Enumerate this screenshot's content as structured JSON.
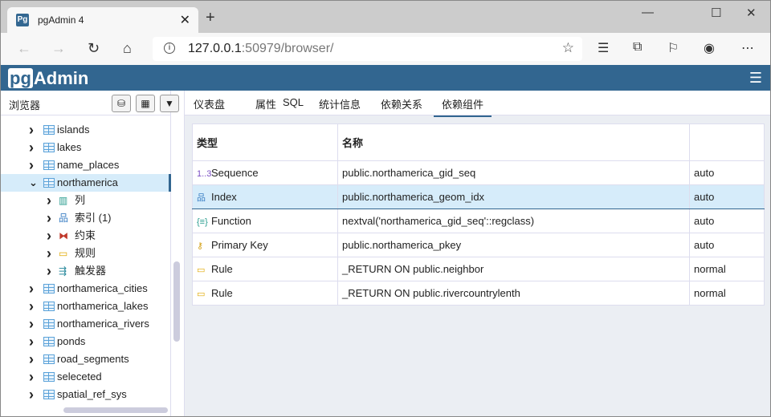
{
  "browser": {
    "tab_title": "pgAdmin 4",
    "favicon": "Pg",
    "url_host": "127.0.0.1",
    "url_rest": ":50979/browser/"
  },
  "app": {
    "logo_pg": "pg",
    "logo_rest": "Admin"
  },
  "left": {
    "title": "浏览器",
    "tree": [
      {
        "label": "islands",
        "level": 1,
        "icon": "table",
        "expanded": false
      },
      {
        "label": "lakes",
        "level": 1,
        "icon": "table",
        "expanded": false
      },
      {
        "label": "name_places",
        "level": 1,
        "icon": "table",
        "expanded": false
      },
      {
        "label": "northamerica",
        "level": 1,
        "icon": "table",
        "expanded": true,
        "selected": true
      },
      {
        "label": "列",
        "level": 2,
        "icon": "columns",
        "expanded": false
      },
      {
        "label": "索引 (1)",
        "level": 2,
        "icon": "index",
        "expanded": false
      },
      {
        "label": "约束",
        "level": 2,
        "icon": "constraint",
        "expanded": false
      },
      {
        "label": "规则",
        "level": 2,
        "icon": "rule",
        "expanded": false
      },
      {
        "label": "触发器",
        "level": 2,
        "icon": "trigger",
        "expanded": false
      },
      {
        "label": "northamerica_cities",
        "level": 1,
        "icon": "table",
        "expanded": false
      },
      {
        "label": "northamerica_lakes",
        "level": 1,
        "icon": "table",
        "expanded": false
      },
      {
        "label": "northamerica_rivers",
        "level": 1,
        "icon": "table",
        "expanded": false
      },
      {
        "label": "ponds",
        "level": 1,
        "icon": "table",
        "expanded": false
      },
      {
        "label": "road_segments",
        "level": 1,
        "icon": "table",
        "expanded": false
      },
      {
        "label": "seleceted",
        "level": 1,
        "icon": "table",
        "expanded": false
      },
      {
        "label": "spatial_ref_sys",
        "level": 1,
        "icon": "table",
        "expanded": false
      }
    ]
  },
  "tabs": [
    "仪表盘",
    "属性",
    "SQL",
    "统计信息",
    "依赖关系",
    "依赖组件"
  ],
  "active_tab": 5,
  "table": {
    "headers": [
      "类型",
      "名称",
      ""
    ],
    "rows": [
      {
        "icon": "sequence",
        "type": "Sequence",
        "name": "public.northamerica_gid_seq",
        "dep": "auto"
      },
      {
        "icon": "index",
        "type": "Index",
        "name": "public.northamerica_geom_idx",
        "dep": "auto",
        "selected": true
      },
      {
        "icon": "function",
        "type": "Function",
        "name": "nextval('northamerica_gid_seq'::regclass)",
        "dep": "auto"
      },
      {
        "icon": "key",
        "type": "Primary Key",
        "name": "public.northamerica_pkey",
        "dep": "auto"
      },
      {
        "icon": "rule",
        "type": "Rule",
        "name": "_RETURN ON public.neighbor",
        "dep": "normal"
      },
      {
        "icon": "rule",
        "type": "Rule",
        "name": "_RETURN ON public.rivercountrylenth",
        "dep": "normal"
      }
    ]
  },
  "colors": {
    "brand": "#326690",
    "selection": "#d6ecfa"
  }
}
